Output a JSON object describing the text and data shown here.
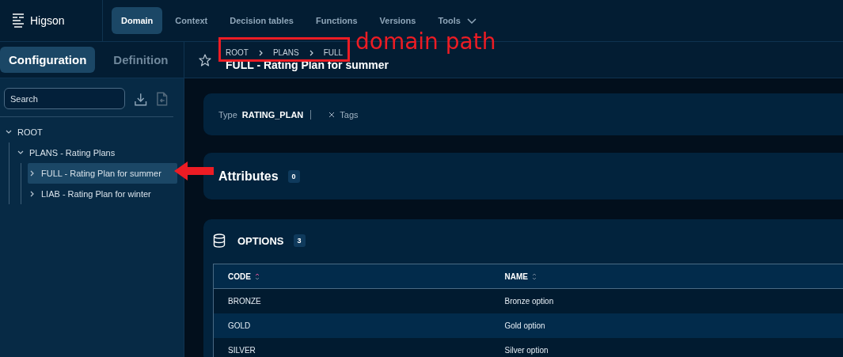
{
  "app": {
    "name": "Higson"
  },
  "nav": [
    {
      "label": "Domain",
      "selected": true,
      "kind": "link"
    },
    {
      "label": "Context",
      "selected": false,
      "kind": "link"
    },
    {
      "label": "Decision tables",
      "selected": false,
      "kind": "link"
    },
    {
      "label": "Functions",
      "selected": false,
      "kind": "link"
    },
    {
      "label": "Versions",
      "selected": false,
      "kind": "link"
    },
    {
      "label": "Tools",
      "selected": false,
      "kind": "dropdown"
    }
  ],
  "sidebar": {
    "tabs": [
      {
        "label": "Configuration",
        "selected": true
      },
      {
        "label": "Definition",
        "selected": false
      }
    ],
    "search": {
      "placeholder": "Search"
    },
    "tree": [
      {
        "label": "ROOT",
        "expanded": true,
        "selected": false,
        "children": [
          {
            "label": "PLANS - Rating Plans",
            "expanded": true,
            "selected": false,
            "children": [
              {
                "label": "FULL - Rating Plan for summer",
                "expanded": false,
                "selected": true
              },
              {
                "label": "LIAB - Rating Plan for winter",
                "expanded": false,
                "selected": false
              }
            ]
          }
        ]
      }
    ]
  },
  "header": {
    "breadcrumb": [
      "ROOT",
      "PLANS",
      "FULL"
    ],
    "title": "FULL - Rating Plan for summer",
    "favorite": false
  },
  "details": {
    "type_label": "Type",
    "type_value": "RATING_PLAN",
    "tags_label": "Tags"
  },
  "attributes": {
    "title": "Attributes",
    "count": "0"
  },
  "options": {
    "title": "OPTIONS",
    "count": "3",
    "columns": [
      {
        "label": "CODE",
        "sorted": true
      },
      {
        "label": "NAME",
        "sorted": false
      }
    ],
    "rows": [
      [
        "BRONZE",
        "Bronze option"
      ],
      [
        "GOLD",
        "Gold option"
      ],
      [
        "SILVER",
        "Silver option"
      ]
    ]
  },
  "annotation": {
    "label": "domain path"
  }
}
